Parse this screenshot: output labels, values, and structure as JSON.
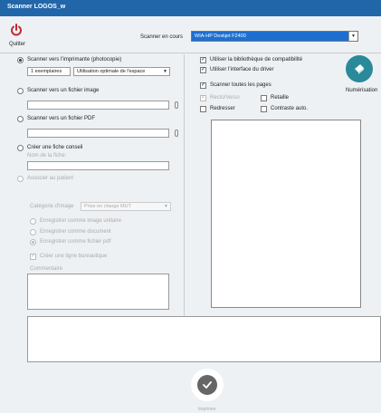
{
  "window": {
    "title": "Scanner LOGOS_w"
  },
  "toolbar": {
    "quit_label": "Quitter"
  },
  "scanner": {
    "label": "Scanner en cours",
    "selected": "WIA-HP Deskjet F2400"
  },
  "left": {
    "option_printer": "Scanner vers l'imprimante (photocopie)",
    "copies": "1 exemplaires",
    "usage": "Utilisation optimale de l'espace",
    "option_image": "Scanner vers un fichier image",
    "option_pdf": "Scanner vers un fichier PDF",
    "option_conseil": "Créer une fiche conseil",
    "fiche_name_label": "Nom de la fiche:",
    "option_patient": "Associer au patient",
    "category_label": "Catégorie d'image",
    "category_value": "Prise en charge MUT",
    "save_unit": "Enregistrer comme image unitaire",
    "save_doc": "Enregistrer comme document",
    "save_pdf": "Enregistrer comme fichier pdf",
    "create_line": "Créer une ligne bureautique",
    "comment_label": "Commentaire"
  },
  "right": {
    "compat": "Utiliser la bibliothèque de compatibilité",
    "driver": "Utiliser l'interface du driver",
    "all_pages": "Scanner toutes les pages",
    "recto_verso": "Recto/Verso",
    "retaille": "Retaille",
    "redresser": "Redresser",
    "contraste": "Contraste auto."
  },
  "actions": {
    "scan_label": "Numérisation",
    "print_label": "Imprimer"
  },
  "colors": {
    "titlebar": "#2266aa",
    "scan_button": "#2a8a9a",
    "quit_icon": "#c0282d"
  }
}
